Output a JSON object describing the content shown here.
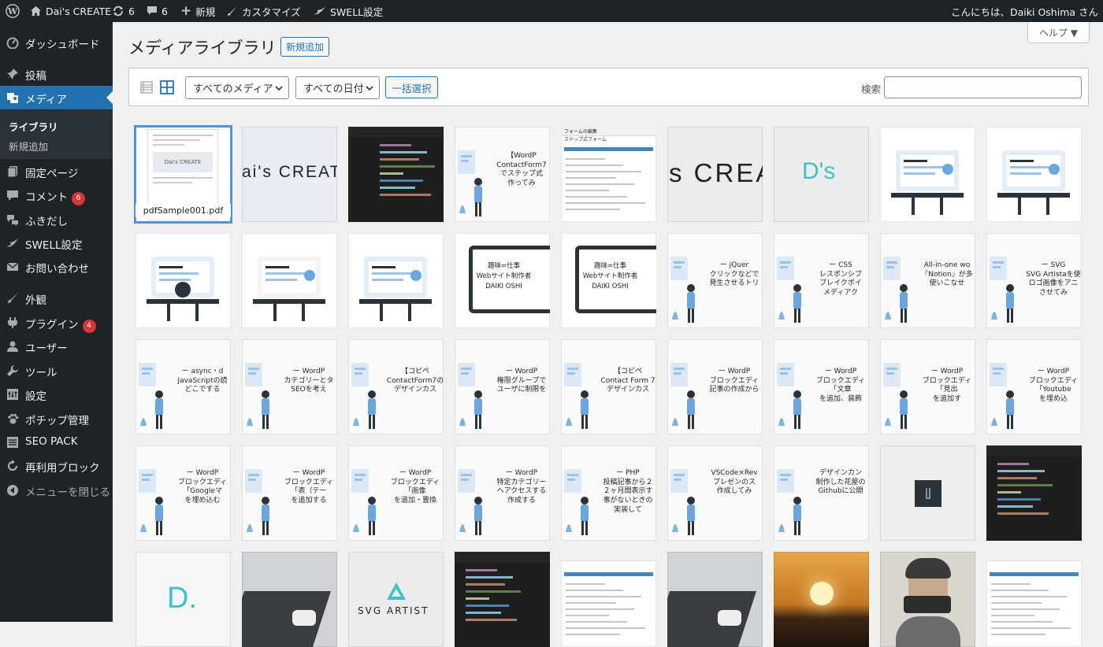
{
  "adminbar": {
    "site_name": "Dai's CREATE",
    "updates": "6",
    "comments": "6",
    "new": "新規",
    "customize": "カスタマイズ",
    "swell": "SWELL設定",
    "greeting": "こんにちは、Daiki Oshima さん"
  },
  "sidebar": {
    "items": [
      {
        "label": "ダッシュボード",
        "icon": "dashboard-icon"
      },
      {
        "label": "投稿",
        "icon": "pushpin-icon"
      },
      {
        "label": "メディア",
        "icon": "media-icon"
      },
      {
        "label": "固定ページ",
        "icon": "page-icon"
      },
      {
        "label": "コメント",
        "icon": "comment-icon",
        "badge": "6"
      },
      {
        "label": "ふきだし",
        "icon": "speech-bubbles-icon"
      },
      {
        "label": "SWELL設定",
        "icon": "swell-icon"
      },
      {
        "label": "お問い合わせ",
        "icon": "mail-icon"
      },
      {
        "label": "外観",
        "icon": "paintbrush-icon"
      },
      {
        "label": "プラグイン",
        "icon": "plugin-icon",
        "badge": "4"
      },
      {
        "label": "ユーザー",
        "icon": "user-icon"
      },
      {
        "label": "ツール",
        "icon": "wrench-icon"
      },
      {
        "label": "設定",
        "icon": "settings-icon"
      },
      {
        "label": "ポチップ管理",
        "icon": "paw-icon"
      },
      {
        "label": "SEO PACK",
        "icon": "seo-icon"
      },
      {
        "label": "再利用ブロック",
        "icon": "reuse-icon"
      },
      {
        "label": "メニューを閉じる",
        "icon": "collapse-icon"
      }
    ],
    "submenu": [
      "ライブラリ",
      "新規追加"
    ]
  },
  "page": {
    "title": "メディアライブラリ",
    "add_new": "新規追加",
    "help": "ヘルプ ▼"
  },
  "toolbar": {
    "filter_media": "すべてのメディア",
    "filter_date": "すべての日付",
    "bulk_select": "一括選択",
    "search_label": "検索",
    "search_value": ""
  },
  "grid": {
    "tiles": [
      {
        "kind": "pdf",
        "filename": "pdfSample001.pdf",
        "text": "Dai's CREATE"
      },
      {
        "kind": "logo",
        "text": "ai's CREAT"
      },
      {
        "kind": "code",
        "text": ""
      },
      {
        "kind": "card",
        "text": "【WordP\nContactForm7\nでステップ式\n作ってみ"
      },
      {
        "kind": "form",
        "text": "フォームの編集\nステップ式フォーム"
      },
      {
        "kind": "logo2",
        "text": "s CREA"
      },
      {
        "kind": "ds",
        "text": "D's"
      },
      {
        "kind": "illus",
        "text": ""
      },
      {
        "kind": "illus",
        "text": ""
      },
      {
        "kind": "illus2",
        "text": ""
      },
      {
        "kind": "illus3",
        "text": ""
      },
      {
        "kind": "illus4",
        "text": ""
      },
      {
        "kind": "laptop",
        "text": "趣味=仕事\nWebサイト制作者\nDAIKI OSHI"
      },
      {
        "kind": "laptop",
        "text": "趣味=仕事\nWebサイト制作者\nDAIKI OSHI"
      },
      {
        "kind": "card",
        "text": "ー jQuer\nクリックなどで\n発生させるトリ"
      },
      {
        "kind": "card",
        "text": "ー CSS\nレスポンシブ\nブレイクポイ\nメディアク"
      },
      {
        "kind": "card",
        "text": "All-in-one wo\n『Notion』が多\n使いこなせ"
      },
      {
        "kind": "card",
        "text": "ー SVG\nSVG Artistaを使\nロゴ画像をアニ\nさせてみ"
      },
      {
        "kind": "card",
        "text": "ー async・d\nJavaScriptの読\nどこでする"
      },
      {
        "kind": "card",
        "text": "ー WordP\nカテゴリーとタ\nSEOを考え"
      },
      {
        "kind": "card",
        "text": "【コピペ\nContactForm7の\nデザインカス"
      },
      {
        "kind": "card",
        "text": "ー WordP\n権限グループで\nユーザに制限を"
      },
      {
        "kind": "card",
        "text": "【コピペ\nContact Form 7\nデザインカス"
      },
      {
        "kind": "card",
        "text": "ー WordP\nブロックエディ\n記事の作成から"
      },
      {
        "kind": "card",
        "text": "ー WordP\nブロックエディ\n「文章\nを追加、装飾"
      },
      {
        "kind": "card",
        "text": "ー WordP\nブロックエディ\n「見出\nを追加す"
      },
      {
        "kind": "card",
        "text": "ー WordP\nブロックエディ\n「Youtube\nを埋め込"
      },
      {
        "kind": "card",
        "text": "ー WordP\nブロックエディ\n「Googleマ\nを埋め込む"
      },
      {
        "kind": "card",
        "text": "ー WordP\nブロックエディ\n「表（テー\nを追加する"
      },
      {
        "kind": "card",
        "text": "ー WordP\nブロックエディ\n「画像\nを追加・置換"
      },
      {
        "kind": "card",
        "text": "ー WordP\n特定カテゴリー\nへアクセスする\n作成する"
      },
      {
        "kind": "card",
        "text": "ー PHP\n投稿記事から２\n２ヶ月間表示す\n事がないときの\n実装して"
      },
      {
        "kind": "card",
        "text": "VSCode×Rev\nプレゼンのス\n作成してみ"
      },
      {
        "kind": "card",
        "text": "デザインカン\n制作した花屋の\nGithubに公開"
      },
      {
        "kind": "square",
        "text": ""
      },
      {
        "kind": "dark",
        "text": ""
      },
      {
        "kind": "dletter",
        "text": "D."
      },
      {
        "kind": "photo-laptop",
        "text": ""
      },
      {
        "kind": "svgartist",
        "text": "SVG ARTIST"
      },
      {
        "kind": "dark",
        "text": ""
      },
      {
        "kind": "screens",
        "text": ""
      },
      {
        "kind": "photo-laptop2",
        "text": ""
      },
      {
        "kind": "sunset",
        "text": ""
      },
      {
        "kind": "person",
        "text": ""
      },
      {
        "kind": "screens2",
        "text": ""
      }
    ]
  },
  "colors": {
    "accent": "#2271b1",
    "adminbar": "#1d2327",
    "badge": "#d63638",
    "teal": "#3fc1c9"
  }
}
